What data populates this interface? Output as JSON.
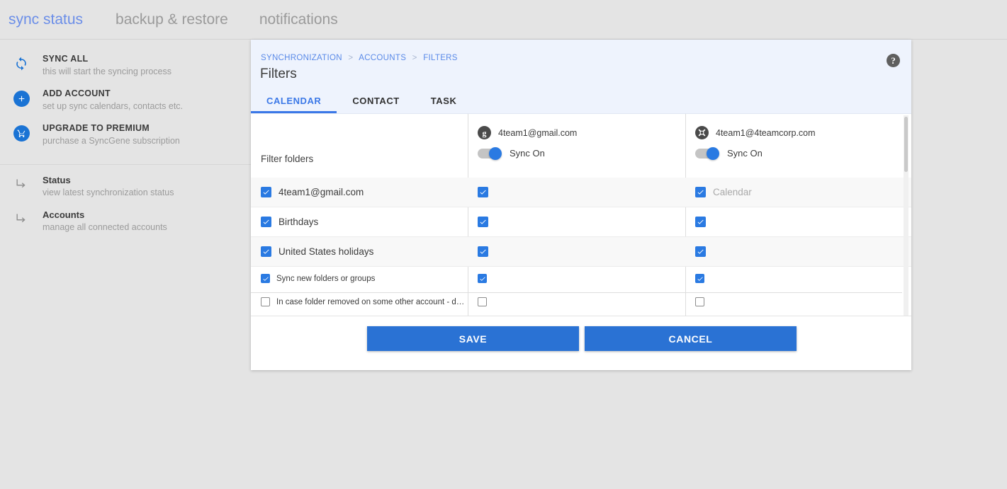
{
  "topnav": {
    "items": [
      {
        "label": "sync status",
        "active": true
      },
      {
        "label": "backup & restore",
        "active": false
      },
      {
        "label": "notifications",
        "active": false
      }
    ]
  },
  "sidebar": {
    "primary": [
      {
        "icon": "sync-icon",
        "title": "SYNC ALL",
        "subtitle": "this will start the syncing process"
      },
      {
        "icon": "plus-icon",
        "title": "ADD ACCOUNT",
        "subtitle": "set up sync calendars, contacts etc."
      },
      {
        "icon": "cart-icon",
        "title": "UPGRADE TO PREMIUM",
        "subtitle": "purchase a SyncGene subscription"
      }
    ],
    "secondary": [
      {
        "icon": "arrow-branch-icon",
        "title": "Status",
        "subtitle": "view latest synchronization status"
      },
      {
        "icon": "arrow-branch-icon",
        "title": "Accounts",
        "subtitle": "manage all connected accounts"
      }
    ]
  },
  "dialog": {
    "breadcrumb": {
      "root": "SYNCHRONIZATION",
      "middle": "ACCOUNTS",
      "current": "FILTERS",
      "separator": ">"
    },
    "title": "Filters",
    "help_icon": "help-circle-icon",
    "tabs": [
      {
        "label": "CALENDAR",
        "active": true
      },
      {
        "label": "CONTACT",
        "active": false
      },
      {
        "label": "TASK",
        "active": false
      }
    ],
    "table": {
      "row_header_label": "Filter folders",
      "accounts": [
        {
          "logo": "google-icon",
          "email": "4team1@gmail.com",
          "sync_label": "Sync On",
          "sync_on": true
        },
        {
          "logo": "exchange-icon",
          "email": "4team1@4teamcorp.com",
          "sync_label": "Sync On",
          "sync_on": true
        }
      ],
      "folders": [
        {
          "label": "4team1@gmail.com",
          "checked": true,
          "cells": [
            {
              "checked": true,
              "label": ""
            },
            {
              "checked": true,
              "label": "Calendar",
              "muted": true
            }
          ]
        },
        {
          "label": "Birthdays",
          "checked": true,
          "cells": [
            {
              "checked": true,
              "label": ""
            },
            {
              "checked": true,
              "label": ""
            }
          ]
        },
        {
          "label": "United States holidays",
          "checked": true,
          "cells": [
            {
              "checked": true,
              "label": ""
            },
            {
              "checked": true,
              "label": ""
            }
          ]
        }
      ],
      "options": [
        {
          "label": "Sync new folders or groups",
          "checked": true,
          "cells": [
            {
              "checked": true
            },
            {
              "checked": true
            }
          ]
        },
        {
          "label": "In case folder removed on some other account - delete i...",
          "checked": false,
          "cells": [
            {
              "checked": false
            },
            {
              "checked": false
            }
          ]
        }
      ]
    },
    "footer": {
      "save_label": "SAVE",
      "cancel_label": "CANCEL"
    }
  },
  "colors": {
    "accent_blue": "#2a72d4",
    "link_blue": "#5a8ae8",
    "tab_active": "#3b78e7",
    "page_bg": "#e4e4e4",
    "dialog_header_bg": "#eef3fd"
  }
}
